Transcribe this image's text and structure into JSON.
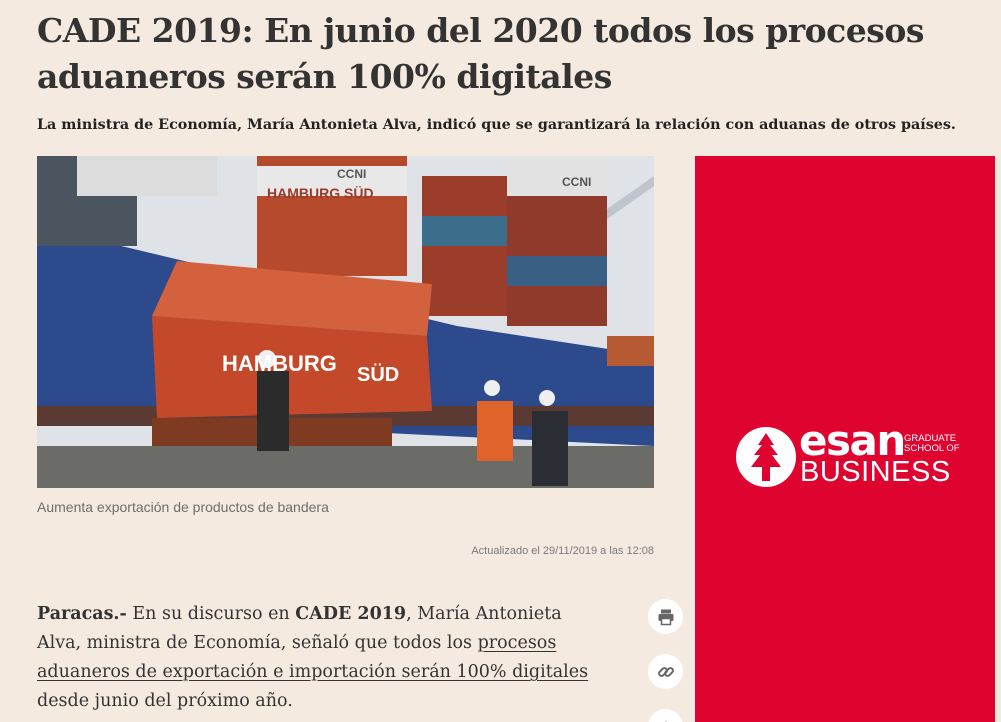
{
  "article": {
    "headline": "CADE 2019: En junio del 2020 todos los procesos aduaneros serán 100% digitales",
    "subtitle": "La ministra de Economía, María Antonieta Alva, indicó que se garantizará la relación con aduanas de otros países.",
    "image_caption": "Aumenta exportación de productos de bandera",
    "updated": "Actualizado el 29/11/2019 a las 12:08",
    "body": {
      "location": "Paracas.-",
      "text_1": " En su discurso en ",
      "event": "CADE 2019",
      "text_2": ", María Antonieta Alva, ministra de Economía, señaló que todos los ",
      "link_text": "procesos aduaneros de exportación e importación serán 100% digitales",
      "text_3": " desde junio del próximo año."
    }
  },
  "image": {
    "container_labels": [
      "HAMBURG SÜD",
      "HAMBURG",
      "SÜD",
      "CCNI",
      "CCNI"
    ]
  },
  "share": {
    "icons": [
      "print-icon",
      "link-icon",
      "more-icon"
    ]
  },
  "ad": {
    "brand": "esan",
    "graduate_line_1": "GRADUATE",
    "graduate_line_2": "SCHOOL OF",
    "business": "BUSINESS",
    "background_color": "#df0330"
  },
  "colors": {
    "page_background": "#f5eadf",
    "text": "#333333"
  }
}
